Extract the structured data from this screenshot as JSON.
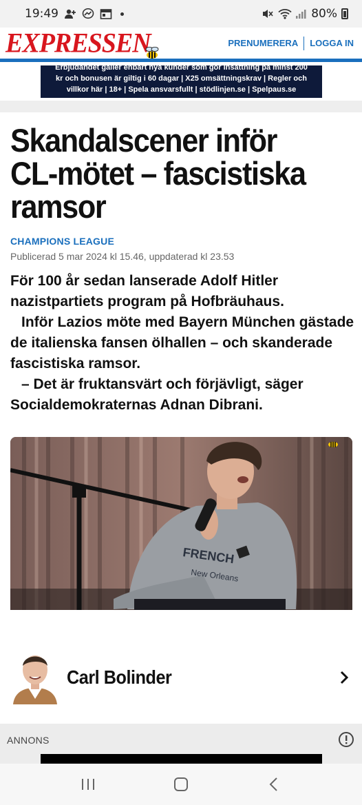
{
  "status_bar": {
    "time": "19:49",
    "battery": "80%",
    "icons": [
      "person-add-icon",
      "messenger-icon",
      "calendar-icon",
      "dot-icon",
      "mute-icon",
      "wifi-icon",
      "signal-icon",
      "battery-icon"
    ]
  },
  "header": {
    "logo_text": "EXPRESSEN",
    "subscribe_label": "PRENUMERERA",
    "login_label": "LOGGA IN",
    "accent_color": "#1a6fbd",
    "brand_color": "#d8161e"
  },
  "ad": {
    "lines": [
      "Erbjudandet gäller enbart nya kunder som gör insättning på minst 200",
      "kr och bonusen är giltig i 60 dagar | X25 omsättningskrav |  Regler och",
      "villkor här | 18+ | Spela ansvarsfullt | stödlinjen.se  | Spelpaus.se"
    ]
  },
  "article": {
    "headline": "Skandalscener inför CL-mötet – fascistiska ramsor",
    "kicker": "CHAMPIONS LEAGUE",
    "published": "Publicerad 5 mar 2024 kl 15.46, uppdaterad kl 23.53",
    "lead": [
      "För 100 år sedan lanserade Adolf Hitler nazistpartiets program på Hofbräuhaus.",
      "Inför Lazios möte med Bayern München gästade de italienska fansen ölhallen – och skanderade fascistiska ramsor.",
      "– Det är fruktansvärt och förjävligt, säger Socialdemokraternas Adnan Dibrani."
    ],
    "image_shirt_text": [
      "FRENCH",
      "New Orleans"
    ]
  },
  "author": {
    "name": "Carl Bolinder"
  },
  "annons": {
    "label": "ANNONS"
  }
}
